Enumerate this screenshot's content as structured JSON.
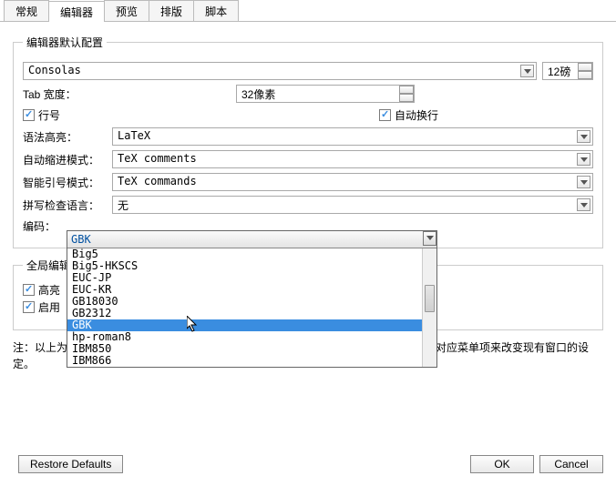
{
  "tabs": {
    "items": [
      "常规",
      "编辑器",
      "预览",
      "排版",
      "脚本"
    ],
    "active_index": 1
  },
  "fieldsets": {
    "defaults_legend": "编辑器默认配置",
    "global_legend": "全局编辑器选项"
  },
  "defaults": {
    "font_value": "Consolas",
    "font_size": "12磅",
    "tab_width_label": "Tab 宽度：",
    "tab_width_value": "32像素",
    "line_numbers_label": "行号",
    "wrap_label": "自动换行",
    "syntax_label": "语法高亮：",
    "syntax_value": "LaTeX",
    "autoindent_label": "自动缩进模式：",
    "autoindent_value": "TeX comments",
    "smartquotes_label": "智能引号模式：",
    "smartquotes_value": "TeX commands",
    "spellcheck_label": "拼写检查语言：",
    "spellcheck_value": "无",
    "encoding_label": "编码：",
    "encoding_value": "GBK",
    "encoding_options": [
      "Big5",
      "Big5-HKSCS",
      "EUC-JP",
      "EUC-KR",
      "GB18030",
      "GB2312",
      "GBK",
      "hp-roman8",
      "IBM850",
      "IBM866"
    ],
    "encoding_highlighted": "GBK"
  },
  "global": {
    "highlight_line_label": "高亮",
    "enable_autocomplete_label": "启用"
  },
  "note": "注：以上为默认设置。改变它们不会影响现有已打开窗口。可以通过修改“格式”菜单中的对应菜单项来改变现有窗口的设定。",
  "buttons": {
    "restore_defaults": "Restore Defaults",
    "ok": "OK",
    "cancel": "Cancel"
  }
}
